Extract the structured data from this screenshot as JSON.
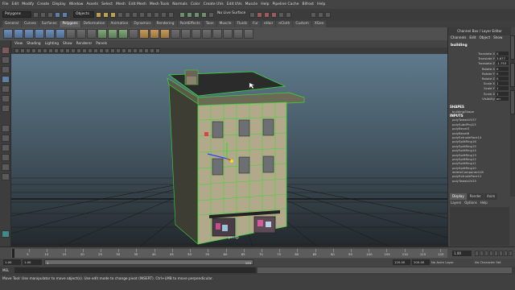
{
  "menu": [
    "File",
    "Edit",
    "Modify",
    "Create",
    "Display",
    "Window",
    "Assets",
    "Select",
    "Mesh",
    "Edit Mesh",
    "Mesh Tools",
    "Normals",
    "Color",
    "Create UVs",
    "Edit UVs",
    "Muscle",
    "Help",
    "Pipeline Cache",
    "Bifrost",
    "Help"
  ],
  "statusline": {
    "menu_set": "Polygons",
    "selector": "Objects",
    "snap_label": "No Live Surface"
  },
  "shelf_tabs": [
    "General",
    "Curves",
    "Surfaces",
    "Polygons",
    "Deformation",
    "Animation",
    "Dynamics",
    "Rendering",
    "PaintEffects",
    "Toon",
    "Muscle",
    "Fluids",
    "Fur",
    "nHair",
    "nCloth",
    "Custom",
    "XGen"
  ],
  "shelf_active": "Polygons",
  "panel_menu": [
    "View",
    "Shading",
    "Lighting",
    "Show",
    "Renderer",
    "Panels"
  ],
  "viewport_label": "persp",
  "channel_box": {
    "title": "Channel Box / Layer Editor",
    "menus": [
      "Channels",
      "Edit",
      "Object",
      "Show"
    ],
    "object": "building",
    "attributes": [
      {
        "name": "Translate X",
        "value": "0"
      },
      {
        "name": "Translate Y",
        "value": "3.677"
      },
      {
        "name": "Translate Z",
        "value": "-1.753"
      },
      {
        "name": "Rotate X",
        "value": "0"
      },
      {
        "name": "Rotate Y",
        "value": "0"
      },
      {
        "name": "Rotate Z",
        "value": "0"
      },
      {
        "name": "Scale X",
        "value": "1"
      },
      {
        "name": "Scale Y",
        "value": "1"
      },
      {
        "name": "Scale Z",
        "value": "1"
      },
      {
        "name": "Visibility",
        "value": "on"
      }
    ],
    "shapes_header": "SHAPES",
    "shapes": [
      "buildingShape"
    ],
    "inputs_header": "INPUTS",
    "inputs": [
      "polyTweakUV37",
      "polySubdProj13",
      "polyBevel3",
      "polyBevel6",
      "polyExtrudeFace14",
      "polySplitRing16",
      "polySplitRing15",
      "polySplitRing14",
      "polySplitRing13",
      "polySplitRing12",
      "polySplitRing11",
      "polySplitRing10",
      "deleteComponent18",
      "polyExtrudeFace12",
      "polyTweakUV25"
    ],
    "layer_tabs": [
      "Display",
      "Render",
      "Anim"
    ],
    "layer_menus": [
      "Layers",
      "Options",
      "Help"
    ]
  },
  "timeline": {
    "ticks": [
      "5",
      "10",
      "15",
      "20",
      "25",
      "30",
      "35",
      "40",
      "45",
      "50",
      "55",
      "60",
      "65",
      "70",
      "75",
      "80",
      "85",
      "90",
      "95",
      "100",
      "105",
      "110",
      "115",
      "120"
    ],
    "current_frame": "1.00"
  },
  "range": {
    "start": "1.00",
    "inner_start": "1.00",
    "bar_start": "1",
    "bar_end": "120",
    "inner_end": "120.00",
    "end": "200.00",
    "anim_layer": "No Anim Layer",
    "char_set": "No Character Set"
  },
  "command": {
    "label": "MEL"
  },
  "helpline": "Move Tool: Use manipulator to move object(s). Use edit mode to change pivot (INSERT). Ctrl+LMB to move perpendicular."
}
